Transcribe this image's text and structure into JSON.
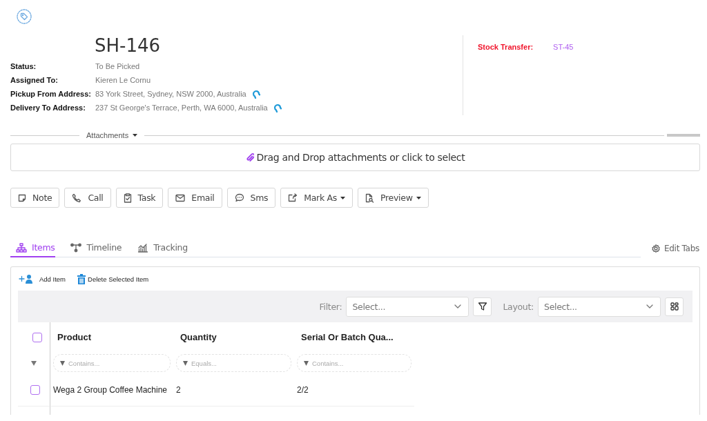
{
  "header": {
    "title": "SH-146",
    "fields": [
      {
        "label": "Status:",
        "value": "To Be Picked",
        "kind": "text"
      },
      {
        "label": "Assigned To:",
        "value": "Kieren Le Cornu",
        "kind": "text"
      },
      {
        "label": "Pickup From Address:",
        "value": "83 York Street, Sydney, NSW 2000, Australia",
        "kind": "address"
      },
      {
        "label": "Delivery To Address:",
        "value": "237 St George's Terrace, Perth, WA 6000, Australia",
        "kind": "address"
      }
    ],
    "related": {
      "label": "Stock Transfer:",
      "value": "ST-45"
    }
  },
  "attachments": {
    "label": "Attachments",
    "dropzone": "Drag and Drop attachments or click to select"
  },
  "actions": [
    {
      "label": "Note",
      "kind": "note",
      "dropdown": false
    },
    {
      "label": "Call",
      "kind": "call",
      "dropdown": false
    },
    {
      "label": "Task",
      "kind": "task",
      "dropdown": false
    },
    {
      "label": "Email",
      "kind": "email",
      "dropdown": false
    },
    {
      "label": "Sms",
      "kind": "sms",
      "dropdown": false
    },
    {
      "label": "Mark As",
      "kind": "mark",
      "dropdown": true
    },
    {
      "label": "Preview",
      "kind": "preview",
      "dropdown": true
    }
  ],
  "tabs": [
    {
      "label": "Items",
      "kind": "items",
      "selected": true
    },
    {
      "label": "Timeline",
      "kind": "timeline",
      "selected": false
    },
    {
      "label": "Tracking",
      "kind": "tracking",
      "selected": false
    }
  ],
  "edit_tabs": "Edit Tabs",
  "toolbar": {
    "add": "Add Item",
    "delete": "Delete Selected Item"
  },
  "filter": {
    "label": "Filter:",
    "placeholder": "Select..."
  },
  "layout": {
    "label": "Layout:",
    "placeholder": "Select..."
  },
  "table": {
    "select_all": false,
    "columns": [
      {
        "title": "Product",
        "filter_placeholder": "Contains..."
      },
      {
        "title": "Quantity",
        "filter_placeholder": "Equals..."
      },
      {
        "title": "Serial Or Batch Qua...",
        "filter_placeholder": "Contains..."
      }
    ],
    "rows": [
      {
        "checked": false,
        "cells": [
          "Wega 2 Group Coffee Machine",
          "2",
          "2/2"
        ]
      }
    ]
  }
}
